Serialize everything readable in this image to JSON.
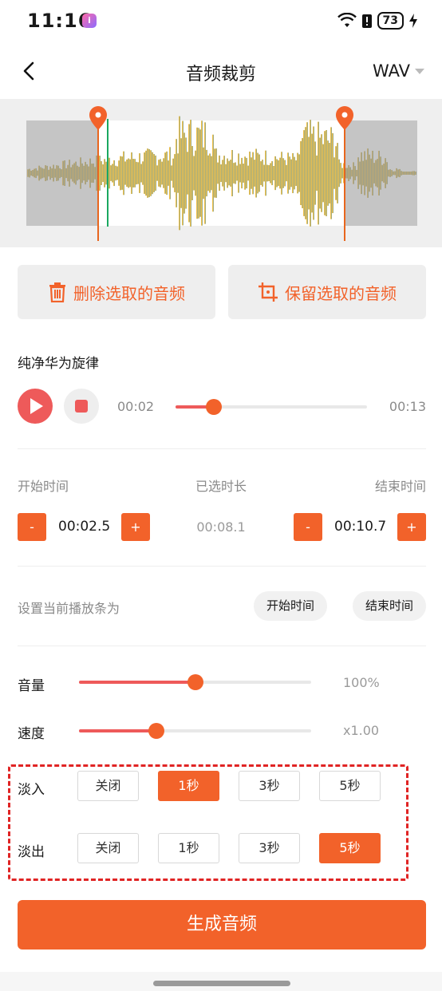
{
  "status_bar": {
    "time": "11:16",
    "battery": "73",
    "app_badge": "i"
  },
  "header": {
    "title": "音频裁剪",
    "format": "WAV"
  },
  "waveform": {
    "start_handle_pct": 0.19,
    "playhead_pct": 0.21,
    "end_handle_pct": 0.82
  },
  "actions": {
    "delete_label": "删除选取的音频",
    "keep_label": "保留选取的音频"
  },
  "track": {
    "name": "纯净华为旋律"
  },
  "player": {
    "current": "00:02",
    "total": "00:13",
    "progress": 0.2
  },
  "range": {
    "start_label": "开始时间",
    "selected_label": "已选时长",
    "end_label": "结束时间",
    "start_value": "00:02.5",
    "selected_value": "00:08.1",
    "end_value": "00:10.7",
    "minus": "-",
    "plus": "+"
  },
  "set_playbar": {
    "label": "设置当前播放条为",
    "start_btn": "开始时间",
    "end_btn": "结束时间"
  },
  "volume": {
    "label": "音量",
    "value": "100%",
    "level": 0.5
  },
  "speed": {
    "label": "速度",
    "value": "x1.00",
    "level": 0.333
  },
  "fade_in": {
    "label": "淡入",
    "options": [
      "关闭",
      "1秒",
      "3秒",
      "5秒"
    ],
    "selected": 1
  },
  "fade_out": {
    "label": "淡出",
    "options": [
      "关闭",
      "1秒",
      "3秒",
      "5秒"
    ],
    "selected": 3
  },
  "generate": {
    "label": "生成音频"
  },
  "colors": {
    "accent": "#f2622a",
    "red": "#ee5a5a",
    "dashed_highlight": "#e02424"
  }
}
